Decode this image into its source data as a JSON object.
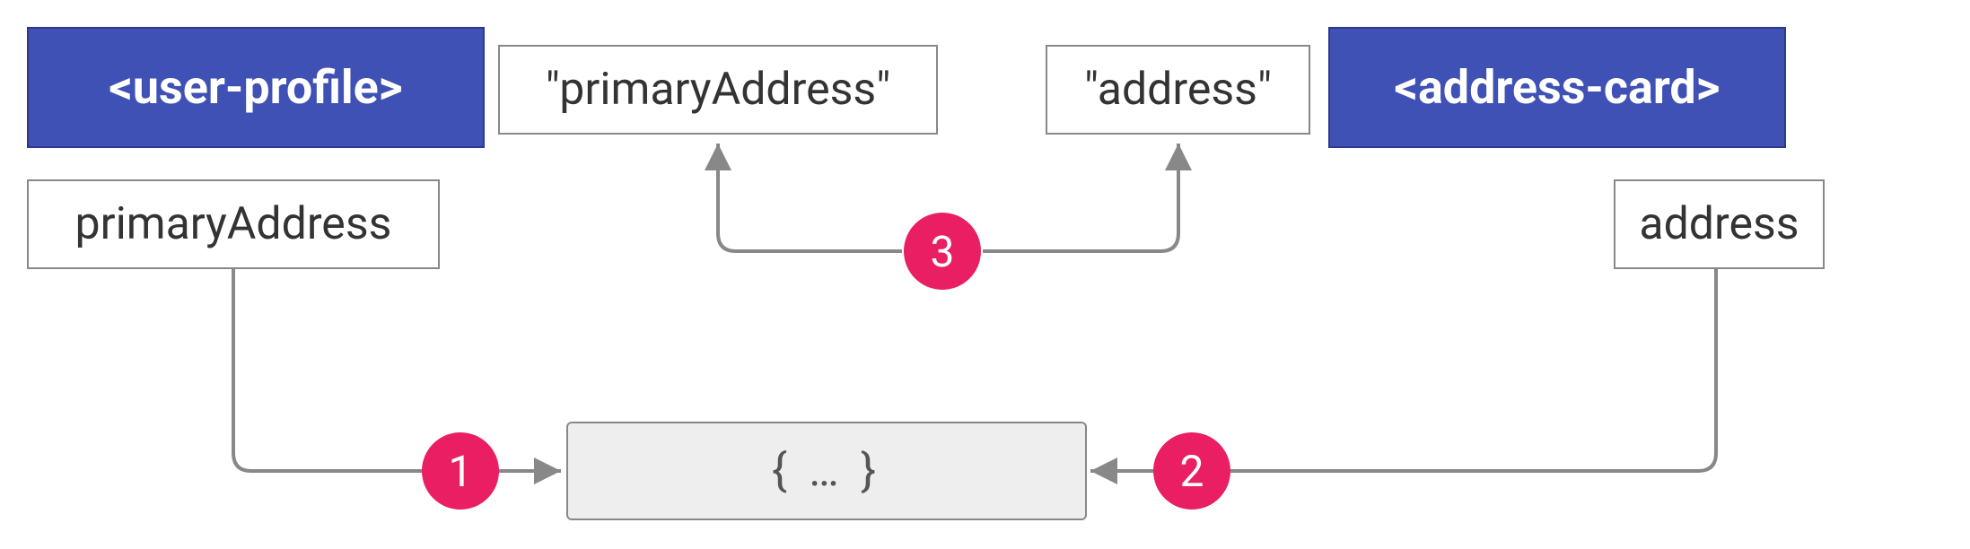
{
  "nodes": {
    "left_element": "<user-profile>",
    "left_property": "primaryAddress",
    "left_property_quoted": "\"primaryAddress\"",
    "right_element": "<address-card>",
    "right_property": "address",
    "right_property_quoted": "\"address\"",
    "shared_object": "{  …  }"
  },
  "badges": {
    "one": "1",
    "two": "2",
    "three": "3"
  },
  "colors": {
    "element_box": "#3f51b5",
    "badge": "#e91e63",
    "shared_bg": "#eeeeee"
  }
}
